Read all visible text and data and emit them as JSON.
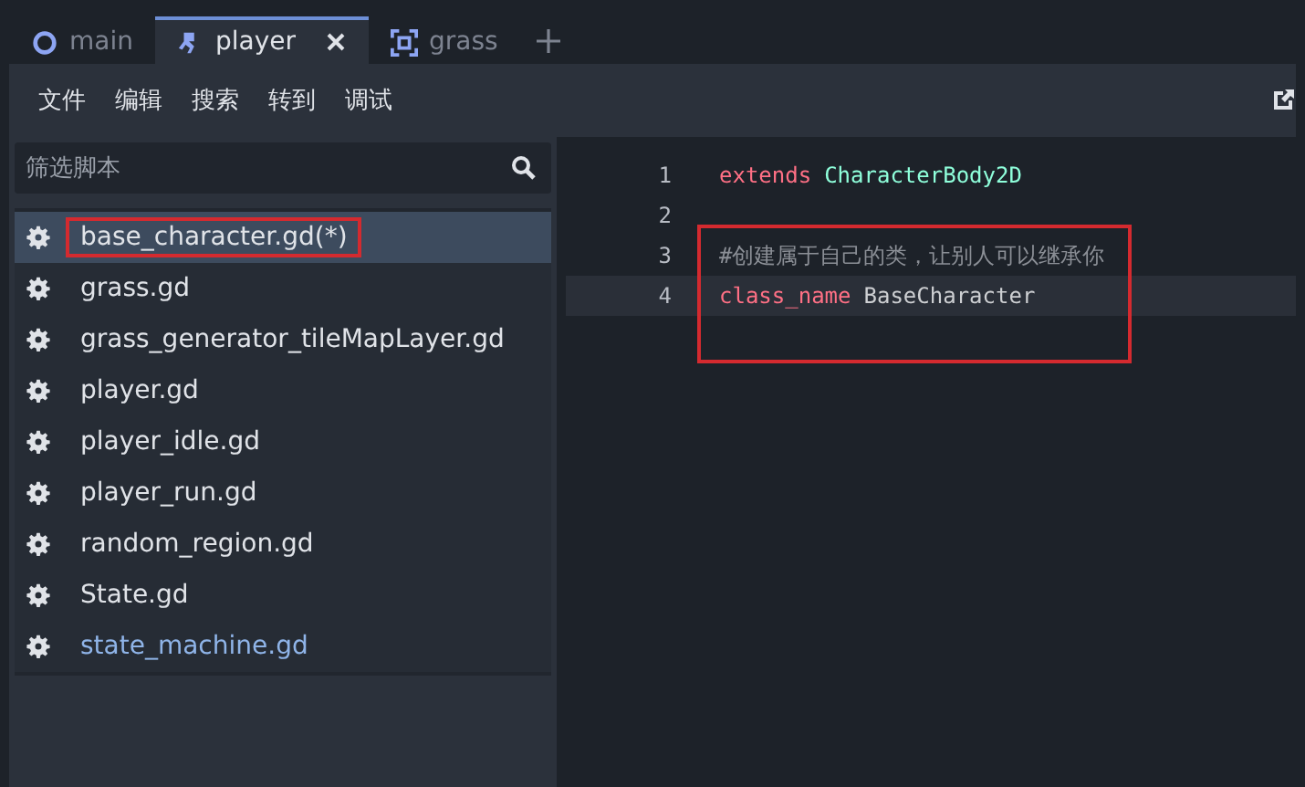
{
  "tabs": [
    {
      "label": "main",
      "selected": false
    },
    {
      "label": "player",
      "selected": true
    },
    {
      "label": "grass",
      "selected": false
    }
  ],
  "menu": [
    "文件",
    "编辑",
    "搜索",
    "转到",
    "调试"
  ],
  "filter": {
    "placeholder": "筛选脚本"
  },
  "scripts": [
    {
      "name": "base_character.gd(*)",
      "selected": true,
      "active": false,
      "highlighted": true
    },
    {
      "name": "grass.gd",
      "selected": false,
      "active": false,
      "highlighted": false
    },
    {
      "name": "grass_generator_tileMapLayer.gd",
      "selected": false,
      "active": false,
      "highlighted": false
    },
    {
      "name": "player.gd",
      "selected": false,
      "active": false,
      "highlighted": false
    },
    {
      "name": "player_idle.gd",
      "selected": false,
      "active": false,
      "highlighted": false
    },
    {
      "name": "player_run.gd",
      "selected": false,
      "active": false,
      "highlighted": false
    },
    {
      "name": "random_region.gd",
      "selected": false,
      "active": false,
      "highlighted": false
    },
    {
      "name": "State.gd",
      "selected": false,
      "active": false,
      "highlighted": false
    },
    {
      "name": "state_machine.gd",
      "selected": false,
      "active": true,
      "highlighted": false
    }
  ],
  "code": [
    {
      "number": "1",
      "tokens": [
        {
          "text": "extends",
          "kind": "keyword"
        },
        {
          "text": "CharacterBody2D",
          "kind": "type"
        }
      ],
      "current": false,
      "highlighted": false
    },
    {
      "number": "2",
      "current": false,
      "highlighted": false
    },
    {
      "number": "3",
      "tokens": [
        {
          "text": "#创建属于自己的类，让别人可以继承你",
          "kind": "comment"
        }
      ],
      "current": false,
      "highlighted": true
    },
    {
      "number": "4",
      "tokens": [
        {
          "text": "class_name",
          "kind": "keyword"
        },
        {
          "text": "BaseCharacter",
          "kind": "plain"
        }
      ],
      "current": true,
      "highlighted": true
    }
  ]
}
